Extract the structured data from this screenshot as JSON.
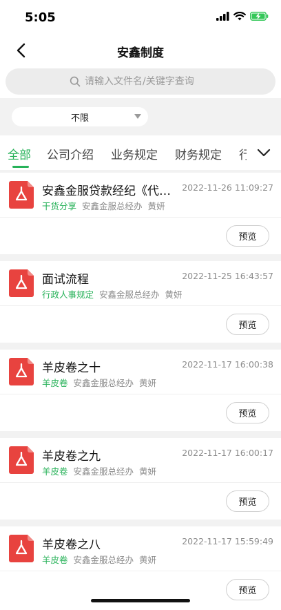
{
  "status_bar": {
    "time": "5:05",
    "battery_color": "#34c759"
  },
  "nav": {
    "title": "安鑫制度",
    "back_icon": "chevron-left-icon"
  },
  "search": {
    "placeholder": "请输入文件名/关键字查询",
    "value": ""
  },
  "filter": {
    "selected": "不限"
  },
  "tabs": {
    "items": [
      {
        "label": "全部",
        "active": true
      },
      {
        "label": "公司介绍",
        "active": false
      },
      {
        "label": "业务规定",
        "active": false
      },
      {
        "label": "财务规定",
        "active": false
      },
      {
        "label": "行",
        "active": false
      }
    ],
    "more_icon": "chevron-down-icon"
  },
  "documents": [
    {
      "title": "安鑫金服贷款经纪《代…",
      "date": "2022-11-26 11:09:27",
      "category": "干货分享",
      "department": "安鑫金服总经办",
      "author": "黄妍",
      "preview_label": "预览"
    },
    {
      "title": "面试流程",
      "date": "2022-11-25 16:43:57",
      "category": "行政人事规定",
      "department": "安鑫金服总经办",
      "author": "黄妍",
      "preview_label": "预览"
    },
    {
      "title": "羊皮卷之十",
      "date": "2022-11-17 16:00:38",
      "category": "羊皮卷",
      "department": "安鑫金服总经办",
      "author": "黄妍",
      "preview_label": "预览"
    },
    {
      "title": "羊皮卷之九",
      "date": "2022-11-17 16:00:17",
      "category": "羊皮卷",
      "department": "安鑫金服总经办",
      "author": "黄妍",
      "preview_label": "预览"
    },
    {
      "title": "羊皮卷之八",
      "date": "2022-11-17 15:59:49",
      "category": "羊皮卷",
      "department": "安鑫金服总经办",
      "author": "黄妍",
      "preview_label": "预览"
    }
  ],
  "colors": {
    "accent": "#27b259",
    "pdf_icon": "#e8433f"
  }
}
